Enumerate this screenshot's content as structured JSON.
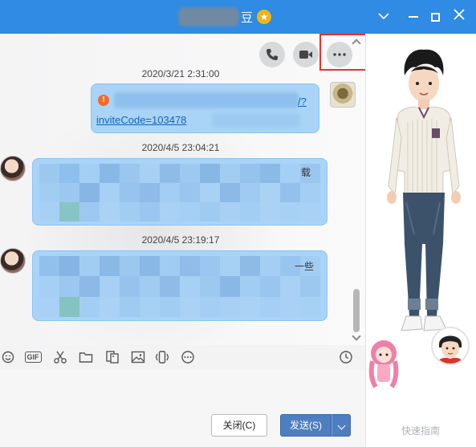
{
  "window": {
    "title_suffix": "豆",
    "star_icon": "star-badge-icon",
    "controls": [
      "chevron-down-icon",
      "minimize-icon",
      "maximize-icon",
      "close-icon"
    ]
  },
  "top_actions": [
    {
      "name": "phone-call-icon"
    },
    {
      "name": "video-call-icon"
    },
    {
      "name": "more-options-icon"
    }
  ],
  "messages": [
    {
      "timestamp": "2020/3/21 2:31:00",
      "sender": "me",
      "link_text_end": "/?",
      "link_text": "inviteCode=103478"
    },
    {
      "timestamp": "2020/4/5 23:04:21",
      "sender": "friend",
      "visible_fragments": [
        "载"
      ]
    },
    {
      "timestamp": "2020/4/5 23:19:17",
      "sender": "friend",
      "visible_fragments": [
        "一些"
      ]
    }
  ],
  "toolbar": {
    "items": [
      "emoji-icon",
      "gif-icon",
      "screenshot-scissors-icon",
      "folder-icon",
      "image-edit-icon",
      "image-icon",
      "shake-icon",
      "more-icon"
    ],
    "gif_label": "GIF",
    "history_icon": "clock-icon"
  },
  "buttons": {
    "close_label": "关闭(C)",
    "send_label": "发送(S)"
  },
  "watermark": "快速指南",
  "colors": {
    "titlebar": "#2f8be3",
    "bubble": "#a9d4f7",
    "send_button": "#4e7ec0",
    "highlight": "#e8322f"
  }
}
